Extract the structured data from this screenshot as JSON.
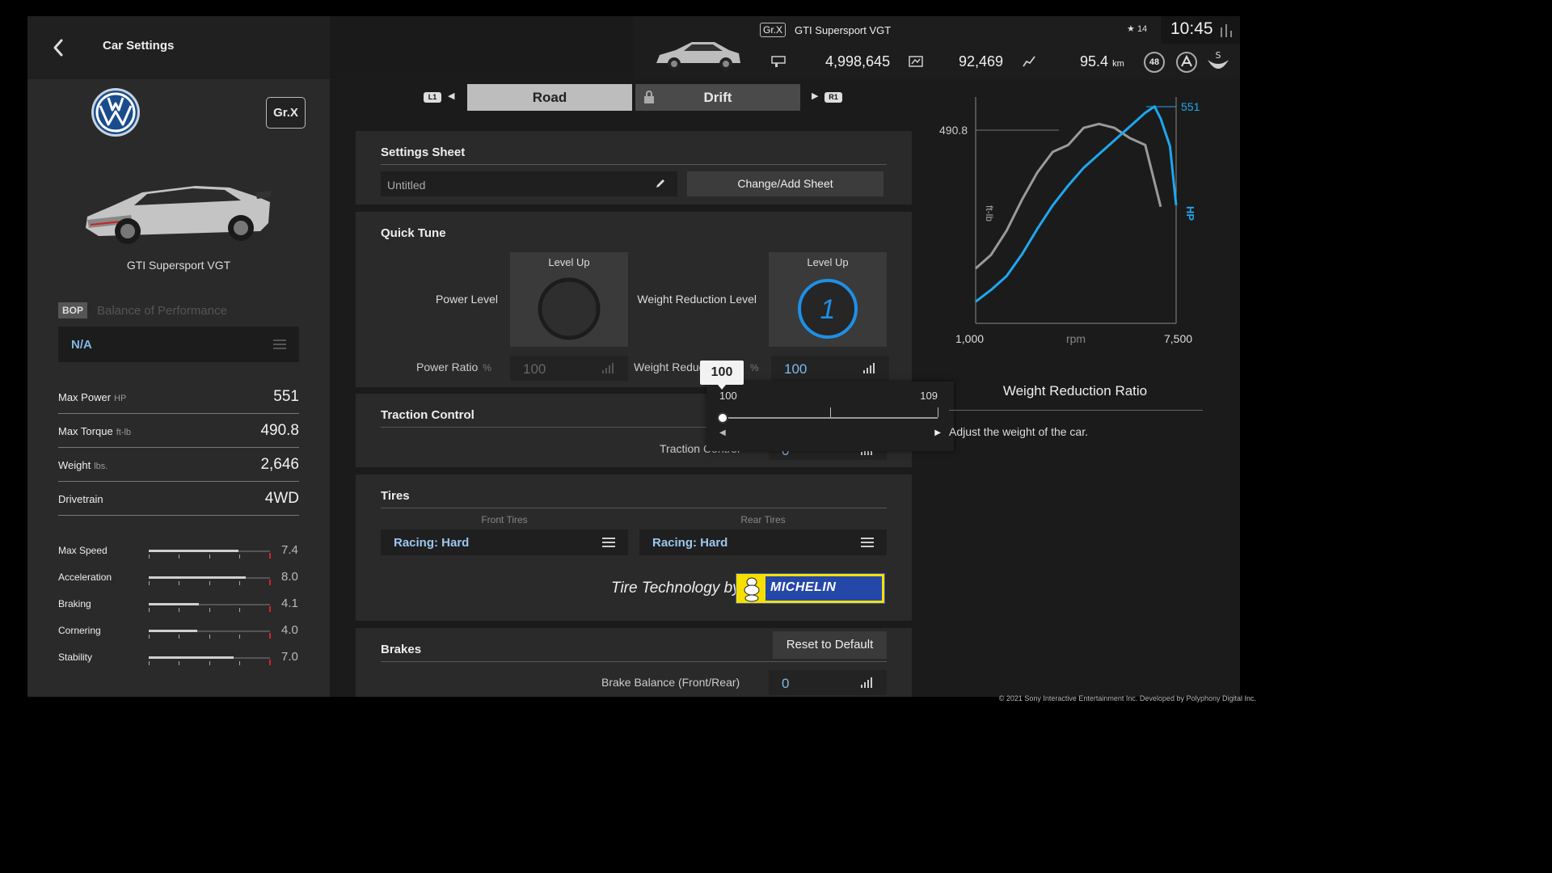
{
  "header": {
    "title": "Car Settings",
    "car_class": "Gr.X",
    "car_name": "GTI Supersport VGT",
    "credits": "4,998,645",
    "mileage_points": "92,469",
    "distance": "95.4",
    "distance_unit": "km",
    "level": "48",
    "friends_count": "14",
    "clock": "10:45"
  },
  "sidebar": {
    "class_box": "Gr.X",
    "car_name": "GTI Supersport VGT",
    "bop_tag": "BOP",
    "bop_label": "Balance of Performance",
    "bop_value": "N/A",
    "specs": [
      {
        "label": "Max Power",
        "unit": "HP",
        "value": "551"
      },
      {
        "label": "Max Torque",
        "unit": "ft-lb",
        "value": "490.8"
      },
      {
        "label": "Weight",
        "unit": "lbs.",
        "value": "2,646"
      },
      {
        "label": "Drivetrain",
        "unit": "",
        "value": "4WD"
      }
    ],
    "performance": [
      {
        "label": "Max Speed",
        "value": "7.4",
        "fill": 0.74
      },
      {
        "label": "Acceleration",
        "value": "8.0",
        "fill": 0.8
      },
      {
        "label": "Braking",
        "value": "4.1",
        "fill": 0.41
      },
      {
        "label": "Cornering",
        "value": "4.0",
        "fill": 0.4
      },
      {
        "label": "Stability",
        "value": "7.0",
        "fill": 0.7
      }
    ]
  },
  "tabs": {
    "left_button": "L1",
    "right_button": "R1",
    "road": "Road",
    "drift": "Drift"
  },
  "settings_sheet": {
    "title": "Settings Sheet",
    "sheet_name": "Untitled",
    "change_button": "Change/Add Sheet"
  },
  "quick_tune": {
    "title": "Quick Tune",
    "power_level_label": "Power Level",
    "power_level_box_title": "Level Up",
    "power_level_value": "",
    "weight_level_label": "Weight Reduction Level",
    "weight_level_box_title": "Level Up",
    "weight_level_value": "1",
    "power_ratio_label": "Power Ratio",
    "power_ratio_unit": "%",
    "power_ratio_value": "100",
    "weight_ratio_label": "Weight Reduct",
    "weight_ratio_unit": "%",
    "weight_ratio_value": "100"
  },
  "traction_control": {
    "title": "Traction Control",
    "label": "Traction Control",
    "value": "0"
  },
  "tires": {
    "title": "Tires",
    "front_label": "Front Tires",
    "rear_label": "Rear Tires",
    "front_value": "Racing: Hard",
    "rear_value": "Racing: Hard",
    "tech_text": "Tire Technology by",
    "brand": "MICHELIN"
  },
  "brakes": {
    "title": "Brakes",
    "reset_button": "Reset to Default",
    "balance_label": "Brake Balance (Front/Rear)",
    "balance_value": "0"
  },
  "slider_popup": {
    "tooltip": "100",
    "min": "100",
    "max": "109",
    "value": 100
  },
  "chart_data": {
    "type": "line",
    "x_min_label": "1,000",
    "x_max_label": "7,500",
    "x_unit_label": "rpm",
    "torque_axis_label": "ft-lb",
    "power_axis_label": "HP",
    "torque_peak_label": "490.8",
    "power_peak_label": "551",
    "xlim": [
      1000,
      7500
    ],
    "series": [
      {
        "name": "ft-lb",
        "color": "#9a9a9a",
        "x": [
          1000,
          1500,
          2000,
          2500,
          3000,
          3500,
          4000,
          4500,
          5000,
          5500,
          6000,
          6500,
          7000
        ],
        "values": [
          280,
          300,
          335,
          380,
          420,
          450,
          460,
          485,
          490.8,
          485,
          470,
          460,
          370
        ]
      },
      {
        "name": "HP",
        "color": "#1ea7f0",
        "x": [
          1000,
          1500,
          2000,
          2500,
          3000,
          3500,
          4000,
          4500,
          5000,
          5500,
          6000,
          6500,
          6800,
          7000,
          7300,
          7500
        ],
        "values": [
          55,
          85,
          120,
          175,
          240,
          300,
          350,
          395,
          430,
          465,
          500,
          535,
          551,
          520,
          450,
          300
        ]
      }
    ]
  },
  "info": {
    "title": "Weight Reduction Ratio",
    "description": "Adjust the weight of the car."
  },
  "footer": {
    "copyright": "© 2021 Sony Interactive Entertainment Inc. Developed by Polyphony Digital Inc."
  }
}
